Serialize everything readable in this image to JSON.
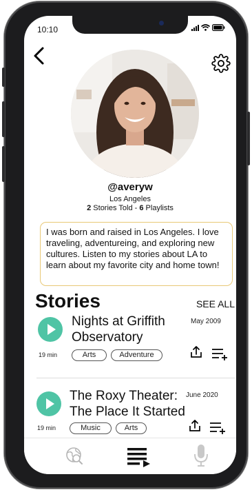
{
  "status": {
    "time": "10:10"
  },
  "profile": {
    "username": "@averyw",
    "location": "Los Angeles",
    "stories_count": "2",
    "stories_label": "Stories Told",
    "separator": " - ",
    "playlists_count": "6",
    "playlists_label": "Playlists"
  },
  "bio": "I was born and raised in Los Angeles. I love traveling, adventureing, and exploring new cultures. Listen to my stories about LA to learn about my favorite city and home town!",
  "stories_section": {
    "title": "Stories",
    "see_all": "SEE ALL"
  },
  "stories": [
    {
      "title_line1": "Nights at Griffith",
      "title_line2": "Observatory",
      "date": "May 2009",
      "duration": "19 min",
      "tags": [
        "Arts",
        "Adventure"
      ]
    },
    {
      "title_line1": "The Roxy Theater:",
      "title_line2": "The Place It Started",
      "date": "June 2020",
      "duration": "19 min",
      "tags": [
        "Music",
        "Arts"
      ]
    }
  ],
  "colors": {
    "accent": "#4fc4a5",
    "bio_border": "#e8c875",
    "frame": "#1c1c1e"
  },
  "icons": {
    "back": "chevron-left-icon",
    "settings": "gear-icon",
    "play": "play-icon",
    "share": "share-icon",
    "queue": "add-to-queue-icon",
    "tab_explore": "globe-search-icon",
    "tab_playlists": "playlist-icon",
    "tab_record": "microphone-icon"
  }
}
